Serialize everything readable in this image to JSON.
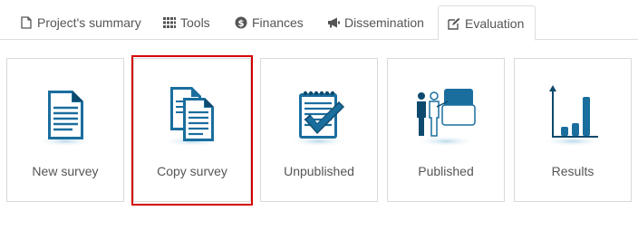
{
  "tabs": [
    {
      "label": "Project's summary",
      "icon": "document-icon"
    },
    {
      "label": "Tools",
      "icon": "grid-icon"
    },
    {
      "label": "Finances",
      "icon": "dollar-icon"
    },
    {
      "label": "Dissemination",
      "icon": "megaphone-icon"
    },
    {
      "label": "Evaluation",
      "icon": "edit-icon",
      "active": true
    }
  ],
  "cards": [
    {
      "label": "New survey",
      "icon": "new-survey-icon"
    },
    {
      "label": "Copy survey",
      "icon": "copy-survey-icon",
      "highlighted": true
    },
    {
      "label": "Unpublished",
      "icon": "unpublished-checklist-icon"
    },
    {
      "label": "Published",
      "icon": "published-presentation-icon"
    },
    {
      "label": "Results",
      "icon": "results-chart-icon"
    }
  ],
  "colors": {
    "icon_blue": "#1a6e9e",
    "icon_dark": "#0d4a6e",
    "highlight_border": "#d40000",
    "card_border": "#d9d9d9"
  }
}
